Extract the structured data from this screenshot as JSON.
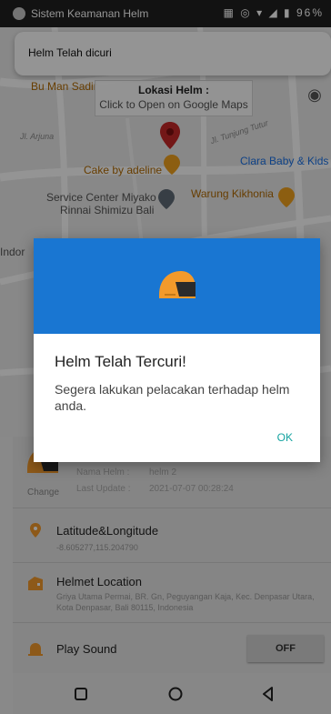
{
  "status_bar": {
    "app_name": "Sistem Keamanan Helm",
    "battery": "96%"
  },
  "notification": {
    "text": "Helm Telah dicuri"
  },
  "map": {
    "location_title": "Lokasi Helm :",
    "location_subtitle": "Click to Open on Google Maps",
    "places": {
      "bu_man": "Bu Man Sadir",
      "arjuna": "Jl. Arjuna",
      "tunjung": "Jl. Tunjung Tutur",
      "cake": "Cake by adeline",
      "clara": "Clara Baby & Kids",
      "service_1": "Service Center Miyako",
      "service_2": "Rinnai Shimizu Bali",
      "warung": "Warung Kikhonia",
      "indo": "Indor"
    }
  },
  "helmet": {
    "change_label": "Change",
    "name_label": "Nama Helm :",
    "name_value": "helm 2",
    "update_label": "Last Update :",
    "update_value": "2021-07-07 00:28:24"
  },
  "coords": {
    "title": "Latitude&Longitude",
    "value": "-8.605277,115.204790"
  },
  "location": {
    "title": "Helmet Location",
    "address": "Griya Utama Permai, BR. Gn, Peguyangan Kaja, Kec. Denpasar Utara, Kota Denpasar, Bali 80115, Indonesia"
  },
  "sound": {
    "title": "Play Sound",
    "button": "OFF"
  },
  "dialog": {
    "title": "Helm Telah Tercuri!",
    "message": "Segera lakukan pelacakan terhadap helm anda.",
    "ok": "OK",
    "icon": "helmet-icon"
  },
  "colors": {
    "accent": "#1976d2",
    "ok": "#14a3a0",
    "helmet": "#f39a2b",
    "pin": "#c62828"
  }
}
